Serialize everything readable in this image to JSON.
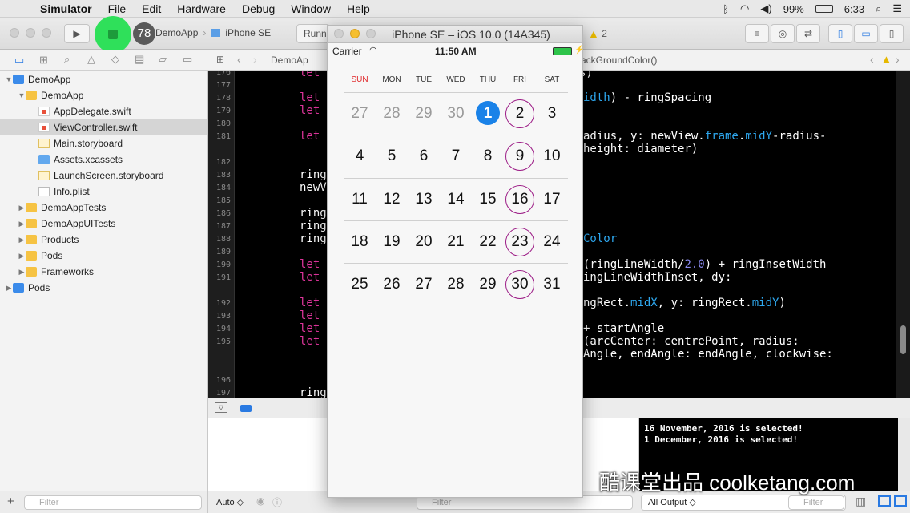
{
  "menubar": {
    "app": "Simulator",
    "items": [
      "File",
      "Edit",
      "Hardware",
      "Debug",
      "Window",
      "Help"
    ],
    "battery": "99%",
    "time": "6:33"
  },
  "toolbar": {
    "badge": "78",
    "scheme_app": "DemoApp",
    "scheme_device": "iPhone SE",
    "activity": "Runni",
    "warnings": "2"
  },
  "navigator": {
    "items": [
      {
        "label": "DemoApp",
        "indent": 0,
        "icon": "proj",
        "disc": "▼"
      },
      {
        "label": "DemoApp",
        "indent": 1,
        "icon": "folder",
        "disc": "▼"
      },
      {
        "label": "AppDelegate.swift",
        "indent": 2,
        "icon": "swift",
        "disc": ""
      },
      {
        "label": "ViewController.swift",
        "indent": 2,
        "icon": "swift",
        "disc": "",
        "selected": true
      },
      {
        "label": "Main.storyboard",
        "indent": 2,
        "icon": "sb",
        "disc": ""
      },
      {
        "label": "Assets.xcassets",
        "indent": 2,
        "icon": "assets",
        "disc": ""
      },
      {
        "label": "LaunchScreen.storyboard",
        "indent": 2,
        "icon": "sb",
        "disc": ""
      },
      {
        "label": "Info.plist",
        "indent": 2,
        "icon": "plist",
        "disc": ""
      },
      {
        "label": "DemoAppTests",
        "indent": 1,
        "icon": "folder",
        "disc": "▶"
      },
      {
        "label": "DemoAppUITests",
        "indent": 1,
        "icon": "folder",
        "disc": "▶"
      },
      {
        "label": "Products",
        "indent": 1,
        "icon": "folder",
        "disc": "▶"
      },
      {
        "label": "Pods",
        "indent": 1,
        "icon": "folder",
        "disc": "▶"
      },
      {
        "label": "Frameworks",
        "indent": 1,
        "icon": "folder",
        "disc": "▶"
      },
      {
        "label": "Pods",
        "indent": 0,
        "icon": "proj",
        "disc": "▶"
      }
    ],
    "filter_placeholder": "Filter"
  },
  "editor": {
    "jump_file": "DemoAp",
    "jump_method": "ackGroundColor()",
    "line_numbers": [
      "176",
      "177",
      "178",
      "179",
      "180",
      "181",
      "",
      "182",
      "183",
      "184",
      "185",
      "186",
      "187",
      "188",
      "189",
      "190",
      "191",
      "",
      "192",
      "193",
      "194",
      "195",
      "",
      "",
      "196",
      "197"
    ]
  },
  "simulator": {
    "title": "iPhone SE – iOS 10.0 (14A345)",
    "carrier": "Carrier",
    "time": "11:50 AM",
    "weekdays": [
      "SUN",
      "MON",
      "TUE",
      "WED",
      "THU",
      "FRI",
      "SAT"
    ],
    "weeks": [
      [
        "27",
        "28",
        "29",
        "30",
        "1",
        "2",
        "3"
      ],
      [
        "4",
        "5",
        "6",
        "7",
        "8",
        "9",
        "10"
      ],
      [
        "11",
        "12",
        "13",
        "14",
        "15",
        "16",
        "17"
      ],
      [
        "18",
        "19",
        "20",
        "21",
        "22",
        "23",
        "24"
      ],
      [
        "25",
        "26",
        "27",
        "28",
        "29",
        "30",
        "31"
      ]
    ]
  },
  "console": {
    "lines": [
      "16 November, 2016 is selected!",
      "1 December, 2016 is selected!"
    ]
  },
  "debug": {
    "auto_label": "Auto ◇",
    "output_label": "All Output ◇",
    "filter_placeholder": "Filter"
  },
  "watermark": "酷课堂出品 coolketang.com"
}
